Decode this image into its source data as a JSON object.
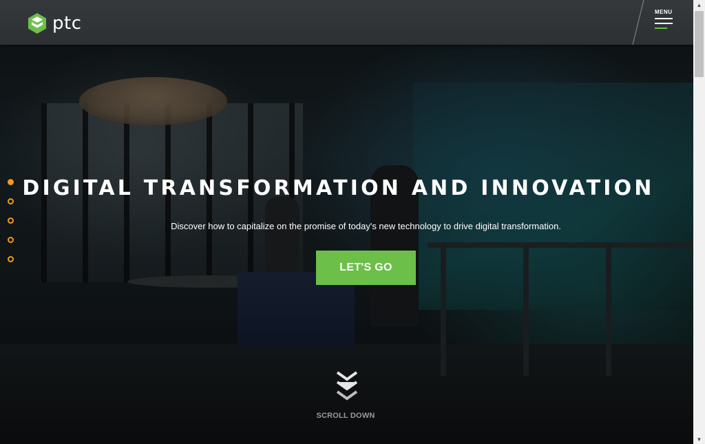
{
  "header": {
    "logo_text": "ptc",
    "menu_label": "MENU"
  },
  "hero": {
    "title": "DIGITAL TRANSFORMATION AND INNOVATION",
    "subtitle": "Discover how to capitalize on the promise of today's new technology to drive digital transformation.",
    "cta_label": "LET'S GO",
    "scroll_label": "SCROLL DOWN"
  },
  "pagination": {
    "count": 5,
    "active_index": 0
  },
  "colors": {
    "brand_green": "#6cc04a",
    "dot_orange": "#f39a1d",
    "header_bg": "#2f3336"
  },
  "icons": {
    "logo": "ptc-logo-icon",
    "menu": "hamburger-icon",
    "scroll": "double-chevron-down-icon"
  }
}
